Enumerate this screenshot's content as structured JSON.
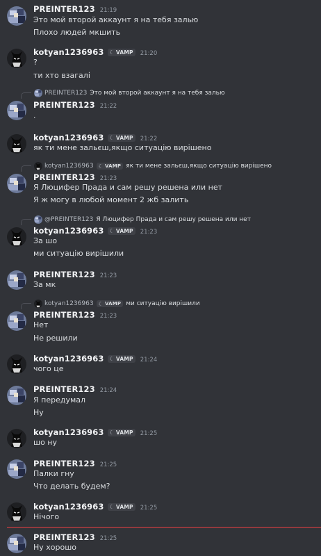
{
  "messages": [
    {
      "author": "PREINTER123",
      "time": "21:19",
      "lines": [
        "Это мой второй аккаунт я на тебя залью",
        "Плохо людей мкшить"
      ]
    },
    {
      "author": "kotyan1236963",
      "tag": "VAMP",
      "time": "21:20",
      "lines": [
        "?",
        "ти хто взагалі"
      ]
    },
    {
      "reply": {
        "author": "PREINTER123",
        "text": "Это мой второй аккаунт я на тебя залью"
      },
      "author": "PREINTER123",
      "time": "21:22",
      "lines": [
        "."
      ]
    },
    {
      "author": "kotyan1236963",
      "tag": "VAMP",
      "time": "21:22",
      "lines": [
        "як ти мене зальєш,якщо ситуацію вирішено"
      ]
    },
    {
      "reply": {
        "author": "kotyan1236963",
        "tag": "VAMP",
        "text": "як ти мене зальєш,якщо ситуацію вирішено"
      },
      "author": "PREINTER123",
      "time": "21:23",
      "lines": [
        "Я Люцифер Прада и сам решу решена или нет",
        "Я ж могу в любой момент 2 жб залить"
      ]
    },
    {
      "reply": {
        "author": "@PREINTER123",
        "text": "Я Люцифер Прада и сам решу решена или нет"
      },
      "author": "kotyan1236963",
      "tag": "VAMP",
      "time": "21:23",
      "lines": [
        "За шо",
        "ми ситуацію вирішили"
      ]
    },
    {
      "author": "PREINTER123",
      "time": "21:23",
      "lines": [
        "За мк"
      ]
    },
    {
      "reply": {
        "author": "kotyan1236963",
        "tag": "VAMP",
        "text": "ми ситуацію вирішили"
      },
      "author": "PREINTER123",
      "time": "21:23",
      "lines": [
        "Нет",
        "Не решили"
      ]
    },
    {
      "author": "kotyan1236963",
      "tag": "VAMP",
      "time": "21:24",
      "lines": [
        "чого це"
      ]
    },
    {
      "author": "PREINTER123",
      "time": "21:24",
      "lines": [
        "Я передумал",
        "Ну"
      ]
    },
    {
      "author": "kotyan1236963",
      "tag": "VAMP",
      "time": "21:25",
      "lines": [
        "шо ну"
      ]
    },
    {
      "author": "PREINTER123",
      "time": "21:25",
      "lines": [
        "Палки гну",
        "Что делать будем?"
      ]
    },
    {
      "author": "kotyan1236963",
      "tag": "VAMP",
      "time": "21:25",
      "lines": [
        "Нічого"
      ]
    },
    {
      "author": "PREINTER123",
      "time": "21:25",
      "lines": [
        "Ну хорошо"
      ]
    }
  ],
  "icons": {
    "tag_icon": "crescent-moon-icon",
    "avatar_a": "pixel-art-avatar",
    "avatar_b": "black-cat-avatar"
  },
  "colors": {
    "background": "#313338",
    "username": "#f2f3f5",
    "text": "#dbdee1",
    "timestamp": "#949ba4",
    "new_divider": "#f23f43"
  }
}
